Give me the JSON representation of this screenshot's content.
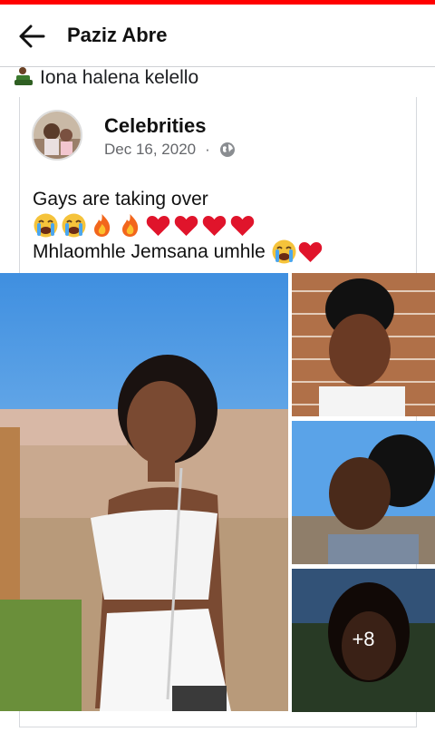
{
  "header": {
    "title": "Paziz Abre"
  },
  "caption": {
    "text": "Iona halena kelello"
  },
  "post": {
    "page_name": "Celebrities",
    "date": "Dec 16, 2020",
    "separator": "·",
    "line1": "Gays are taking over",
    "line3": "Mhlaomhle Jemsana umhle"
  },
  "photos": {
    "more_count": "+8"
  },
  "icons": [
    "back-arrow-icon",
    "globe-icon",
    "crying-emoji-icon",
    "fire-emoji-icon",
    "heart-emoji-icon"
  ],
  "colors": {
    "brand_bar": "#ff0000",
    "meta_text": "#65676b",
    "heart": "#e0142b"
  }
}
